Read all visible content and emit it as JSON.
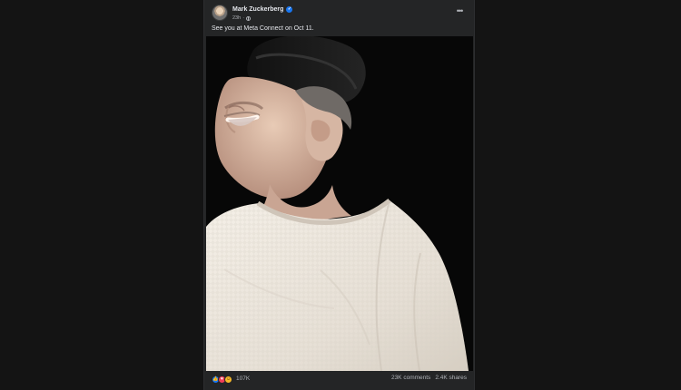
{
  "post": {
    "author": "Mark Zuckerberg",
    "time": "23h",
    "separator": "·",
    "text": "See you at Meta Connect on Oct 11.",
    "menu_icon": "more-horizontal-icon",
    "reactions": {
      "icons": [
        "like-icon",
        "love-icon",
        "care-icon"
      ],
      "count": "107K"
    },
    "stats": {
      "comments": "23K comments",
      "shares": "2.4K shares"
    }
  },
  "colors": {
    "background": "#141414",
    "card": "#242526",
    "text_primary": "#e4e6eb",
    "text_secondary": "#b0b3b8",
    "verified": "#1877f2",
    "like": "#1877f2",
    "love": "#f33e58",
    "care": "#f7b928"
  }
}
